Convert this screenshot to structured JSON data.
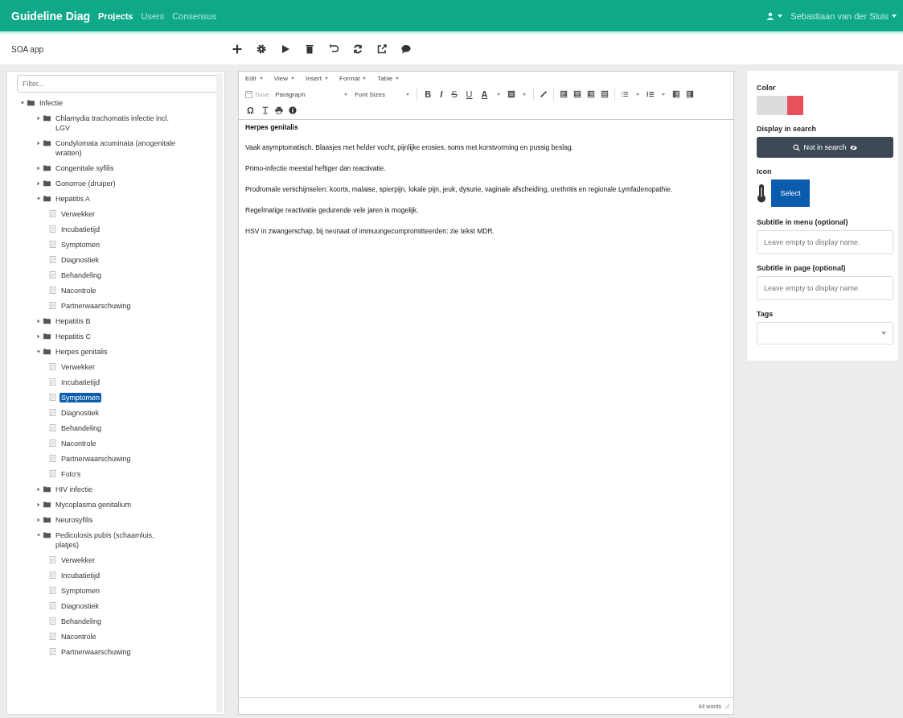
{
  "navbar": {
    "brand": "Guideline Diag",
    "links": [
      {
        "label": "Projects",
        "selected": true
      },
      {
        "label": "Users",
        "selected": false
      },
      {
        "label": "Consensus",
        "selected": false
      }
    ],
    "user": "Sebastiaan van der Sluis"
  },
  "subheader": {
    "title": "SOA app"
  },
  "tree": {
    "filter_placeholder": "Filter...",
    "items": [
      {
        "label": "Infectie",
        "kind": "folder",
        "expanded": true,
        "selected": false,
        "children": [
          {
            "label": "Chlamydia trachomatis infectie incl. LGV",
            "kind": "folder",
            "expanded": false,
            "selected": false
          },
          {
            "label": "Condylomata acuminata (anogenitale wratten)",
            "kind": "folder",
            "expanded": false,
            "selected": false
          },
          {
            "label": "Congenitale syfilis",
            "kind": "folder",
            "expanded": false,
            "selected": false
          },
          {
            "label": "Gonorroe (druiper)",
            "kind": "folder",
            "expanded": false,
            "selected": false
          },
          {
            "label": "Hepatitis A",
            "kind": "folder",
            "expanded": true,
            "selected": false,
            "children": [
              {
                "label": "Verwekker",
                "kind": "page",
                "selected": false
              },
              {
                "label": "Incubatietijd",
                "kind": "page",
                "selected": false
              },
              {
                "label": "Symptomen",
                "kind": "page",
                "selected": false
              },
              {
                "label": "Diagnostiek",
                "kind": "page",
                "selected": false
              },
              {
                "label": "Behandeling",
                "kind": "page",
                "selected": false
              },
              {
                "label": "Nacontrole",
                "kind": "page",
                "selected": false
              },
              {
                "label": "Partnerwaarschuwing",
                "kind": "page",
                "selected": false
              }
            ]
          },
          {
            "label": "Hepatitis B",
            "kind": "folder",
            "expanded": false,
            "selected": false
          },
          {
            "label": "Hepatitis C",
            "kind": "folder",
            "expanded": false,
            "selected": false
          },
          {
            "label": "Herpes genitalis",
            "kind": "folder",
            "expanded": true,
            "selected": false,
            "children": [
              {
                "label": "Verwekker",
                "kind": "page",
                "selected": false
              },
              {
                "label": "Incubatietijd",
                "kind": "page",
                "selected": false
              },
              {
                "label": "Symptomen",
                "kind": "page",
                "selected": true
              },
              {
                "label": "Diagnostiek",
                "kind": "page",
                "selected": false
              },
              {
                "label": "Behandeling",
                "kind": "page",
                "selected": false
              },
              {
                "label": "Nacontrole",
                "kind": "page",
                "selected": false
              },
              {
                "label": "Partnerwaarschuwing",
                "kind": "page",
                "selected": false
              },
              {
                "label": "Foto's",
                "kind": "page",
                "selected": false
              }
            ]
          },
          {
            "label": "HIV infectie",
            "kind": "folder",
            "expanded": false,
            "selected": false
          },
          {
            "label": "Mycoplasma genitalium",
            "kind": "folder",
            "expanded": false,
            "selected": false
          },
          {
            "label": "Neurosyfilis",
            "kind": "folder",
            "expanded": false,
            "selected": false
          },
          {
            "label": "Pediculosis pubis (schaamluis, platjes)",
            "kind": "folder",
            "expanded": true,
            "selected": false,
            "children": [
              {
                "label": "Verwekker",
                "kind": "page",
                "selected": false
              },
              {
                "label": "Incubatietijd",
                "kind": "page",
                "selected": false
              },
              {
                "label": "Symptomen",
                "kind": "page",
                "selected": false
              },
              {
                "label": "Diagnostiek",
                "kind": "page",
                "selected": false
              },
              {
                "label": "Behandeling",
                "kind": "page",
                "selected": false
              },
              {
                "label": "Nacontrole",
                "kind": "page",
                "selected": false
              },
              {
                "label": "Partnerwaarschuwing",
                "kind": "page",
                "selected": false
              }
            ]
          }
        ]
      }
    ]
  },
  "editor": {
    "menus": [
      "Edit",
      "View",
      "Insert",
      "Format",
      "Table"
    ],
    "save": "Save",
    "block_format": "Paragraph",
    "font_size": "Font Sizes",
    "glyph_buttons": [
      "B",
      "I",
      "S",
      "U",
      "A"
    ],
    "special_char": "Ω",
    "heading": "Herpes genitalis",
    "paragraphs": [
      "Vaak asymptomatisch. Blaasjes met helder vocht, pijnlijke erosies, soms met korstvorming en pussig beslag.",
      "Primo-infectie meestal heftiger dan reactivatie.",
      "Prodromale verschijnselen: koorts, malaise, spierpijn, lokale pijn, jeuk, dysurie, vaginale afscheiding, urethritis en regionale Lymfadenopathie.",
      "Regelmatige reactivatie gedurende vele jaren is mogelijk.",
      "HSV in zwangerschap, bij neonaat of immuungecompromitteerden: zie tekst MDR."
    ],
    "word_count": "44 words"
  },
  "properties": {
    "color_label": "Color",
    "color_picker": {
      "color": "#e8505b"
    },
    "search_label": "Display in search",
    "search_button": "Not in search",
    "icon_label": "Icon",
    "select_button": "Select",
    "fields": [
      {
        "label": "Subtitle in menu (optional)",
        "placeholder": "Leave empty to display name."
      },
      {
        "label": "Subtitle in page (optional)",
        "placeholder": "Leave empty to display name."
      }
    ],
    "tags_label": "Tags"
  }
}
